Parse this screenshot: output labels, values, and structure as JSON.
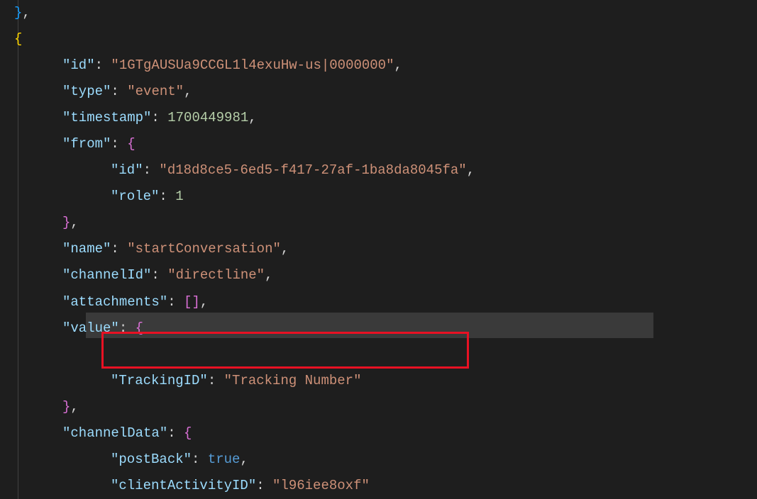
{
  "code": {
    "top_brace": "}",
    "open_brace": "{",
    "comma": ",",
    "colon": ":",
    "space": " ",
    "open_obj": "{",
    "close_obj": "}",
    "open_arr": "[",
    "close_arr": "]",
    "empty_arr": "[]",
    "keys": {
      "id": "\"id\"",
      "type": "\"type\"",
      "timestamp": "\"timestamp\"",
      "from": "\"from\"",
      "role": "\"role\"",
      "name": "\"name\"",
      "channelId": "\"channelId\"",
      "attachments": "\"attachments\"",
      "value": "\"value\"",
      "trackingID": "\"TrackingID\"",
      "channelData": "\"channelData\"",
      "postBack": "\"postBack\"",
      "clientActivityID": "\"clientActivityID\""
    },
    "values": {
      "id": "\"1GTgAUSUa9CCGL1l4exuHw-us|0000000\"",
      "type": "\"event\"",
      "timestamp": "1700449981",
      "from_id": "\"d18d8ce5-6ed5-f417-27af-1ba8da8045fa\"",
      "role": "1",
      "name": "\"startConversation\"",
      "channelId": "\"directline\"",
      "trackingID": "\"Tracking Number\"",
      "postBack": "true",
      "clientActivityID": "\"l96iee8oxf\""
    }
  }
}
